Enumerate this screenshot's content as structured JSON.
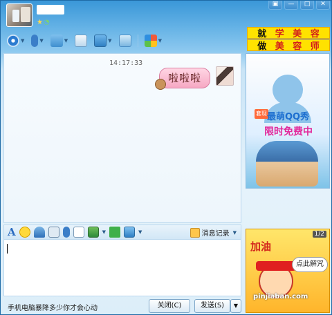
{
  "window": {
    "buttons": [
      "▣",
      "—",
      "□",
      "✕"
    ]
  },
  "ads": {
    "top_line1": [
      "就",
      "学",
      "美",
      "容"
    ],
    "top_line2": [
      "做",
      "美",
      "容",
      "师"
    ],
    "side": {
      "tag": "套现",
      "line1": "最萌QQ秀",
      "line2": "限时免费中"
    },
    "bottom": {
      "page": "1/2",
      "line1": "加油",
      "button": "点此解咒",
      "watermark": "pinjiaban.com"
    }
  },
  "chat": {
    "timestamp": "14:17:33",
    "message": "啦啦啦"
  },
  "input_toolbar": {
    "font_icon": "A",
    "history_label": "消息记录"
  },
  "bottom": {
    "promo": "手机电脑暴降多少你才会心动",
    "close_button": "关闭(C)",
    "send_button": "发送(S)",
    "send_arrow": "▼"
  },
  "colors": {
    "title_bar": "#3a97d8",
    "bubble": "#f6a8c3",
    "ad_yellow": "#ffe200"
  }
}
